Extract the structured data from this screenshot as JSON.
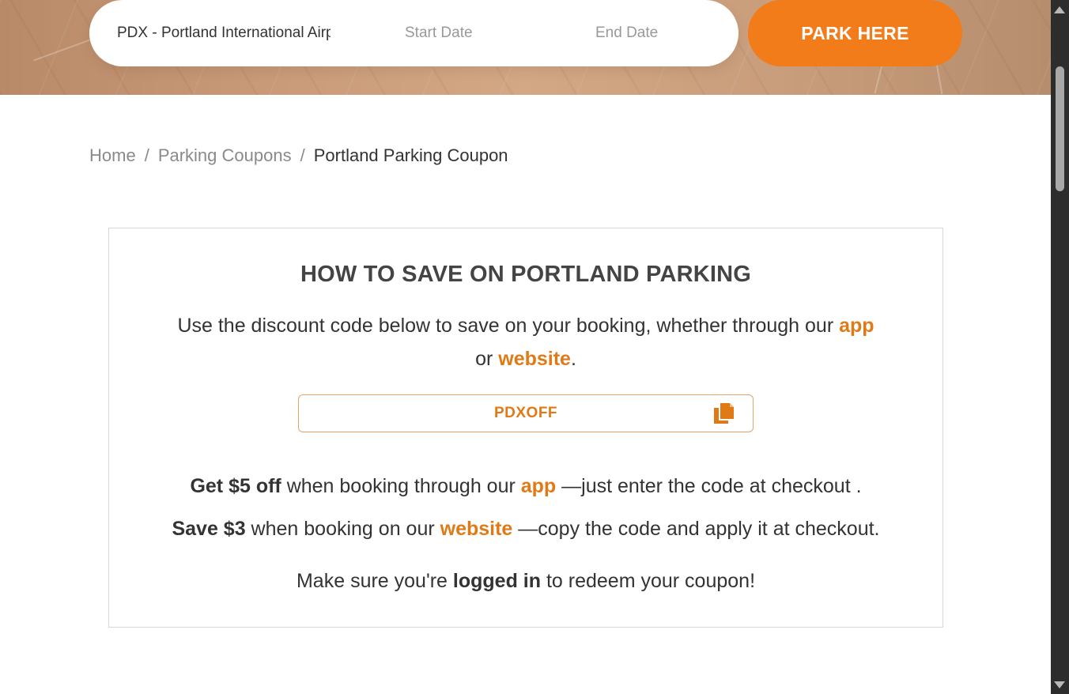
{
  "search": {
    "location_value": "PDX - Portland International Airport",
    "start_placeholder": "Start Date",
    "end_placeholder": "End Date",
    "submit_label": "PARK HERE"
  },
  "breadcrumb": {
    "items": [
      "Home",
      "Parking Coupons",
      "Portland Parking Coupon"
    ],
    "separator": "/"
  },
  "coupon": {
    "title": "HOW TO SAVE ON PORTLAND PARKING",
    "intro_part1": "Use the discount code below to save on your booking, whether through our ",
    "intro_app_link": "app",
    "intro_part2": " or ",
    "intro_website_link": "website",
    "intro_part3": ".",
    "code": "PDXOFF",
    "copy_icon": "copy-icon",
    "app_offer": {
      "bold": "Get $5 off",
      "text1": " when booking through our ",
      "link": "app",
      "text2": " —just enter the code at checkout ."
    },
    "web_offer": {
      "bold": "Save $3",
      "text1": " when booking on our ",
      "link": "website",
      "text2": " —copy the code and apply it at checkout."
    },
    "login_note": {
      "text1": "Make sure you're ",
      "bold": "logged in",
      "text2": " to redeem your coupon!"
    }
  },
  "colors": {
    "accent": "#f27b1a",
    "link": "#e07a17",
    "text": "#333333",
    "muted": "#8a8a8a"
  }
}
